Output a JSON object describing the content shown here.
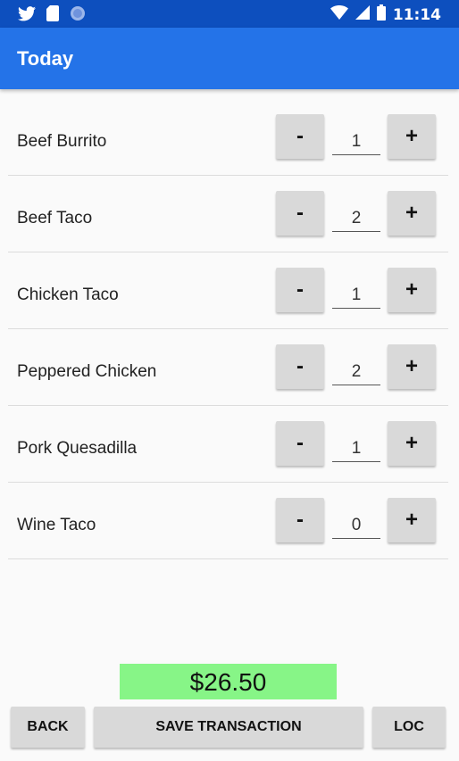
{
  "status_bar": {
    "icons": [
      "twitter-icon",
      "sd-card-icon",
      "circle-icon",
      "wifi-icon",
      "signal-icon",
      "battery-icon"
    ],
    "time": "11:14"
  },
  "app_bar": {
    "title": "Today"
  },
  "items": [
    {
      "name": "Beef Burrito",
      "qty": "1"
    },
    {
      "name": "Beef Taco",
      "qty": "2"
    },
    {
      "name": "Chicken Taco",
      "qty": "1"
    },
    {
      "name": "Peppered Chicken",
      "qty": "2"
    },
    {
      "name": "Pork Quesadilla",
      "qty": "1"
    },
    {
      "name": "Wine Taco",
      "qty": "0"
    }
  ],
  "stepper": {
    "minus_label": "-",
    "plus_label": "+"
  },
  "total": "$26.50",
  "buttons": {
    "back": "BACK",
    "save": "SAVE TRANSACTION",
    "loc": "LOC"
  },
  "colors": {
    "status_bar": "#0d4fbe",
    "app_bar": "#2473e8",
    "total_bg": "#87f587",
    "button_bg": "#d9d9d9"
  }
}
